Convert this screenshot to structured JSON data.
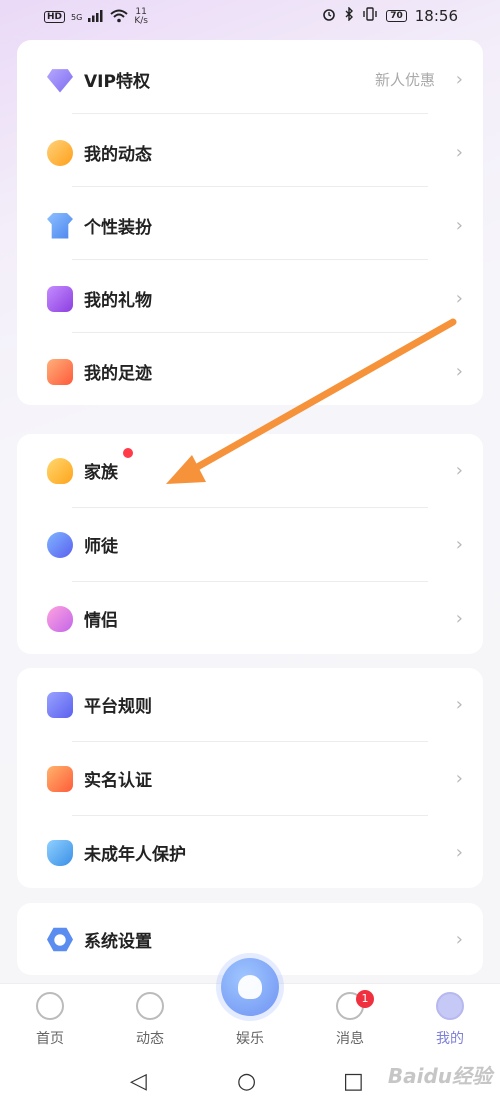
{
  "status_bar": {
    "hd": "HD",
    "signal": "5G",
    "speed_value": "11",
    "speed_unit": "K/s",
    "battery": "70",
    "time": "18:56"
  },
  "menu_groups": [
    {
      "items": [
        {
          "label": "VIP特权",
          "extra": "新人优惠",
          "icon": "diamond-icon",
          "color": "#8f84f2"
        },
        {
          "label": "我的动态",
          "icon": "dynamic-icon",
          "color": "#ffb128"
        },
        {
          "label": "个性装扮",
          "icon": "shirt-icon",
          "color": "#5b9cf0"
        },
        {
          "label": "我的礼物",
          "icon": "gift-icon",
          "color": "#a45be6"
        },
        {
          "label": "我的足迹",
          "icon": "footprint-icon",
          "color": "#ff6b3d"
        }
      ]
    },
    {
      "items": [
        {
          "label": "家族",
          "icon": "medal-icon",
          "color": "#ffb128",
          "red_dot": true
        },
        {
          "label": "师徒",
          "icon": "people-icon",
          "color": "#5a7bf0"
        },
        {
          "label": "情侣",
          "icon": "hearts-icon",
          "color": "#e96bd0"
        }
      ]
    },
    {
      "items": [
        {
          "label": "平台规则",
          "icon": "document-icon",
          "color": "#6c76f2"
        },
        {
          "label": "实名认证",
          "icon": "id-badge-icon",
          "color": "#ff6b3d"
        },
        {
          "label": "未成年人保护",
          "icon": "shield-icon",
          "color": "#4aa8ea"
        }
      ]
    },
    {
      "items": [
        {
          "label": "系统设置",
          "icon": "settings-icon",
          "color": "#5b8cf0"
        }
      ]
    }
  ],
  "tab_bar": {
    "tabs": [
      {
        "label": "首页",
        "icon": "home-icon"
      },
      {
        "label": "动态",
        "icon": "planet-icon"
      },
      {
        "label": "娱乐",
        "icon": "entertainment-icon"
      },
      {
        "label": "消息",
        "icon": "message-icon",
        "badge": "1"
      },
      {
        "label": "我的",
        "icon": "profile-icon",
        "active": true
      }
    ]
  },
  "nav_bar": {
    "back": "◁",
    "home": "○",
    "recent": "□"
  },
  "watermark": "Baidu经验",
  "colors": {
    "accent": "#7d7fd8",
    "annotation_arrow": "#f5923a",
    "badge": "#f0303f"
  }
}
